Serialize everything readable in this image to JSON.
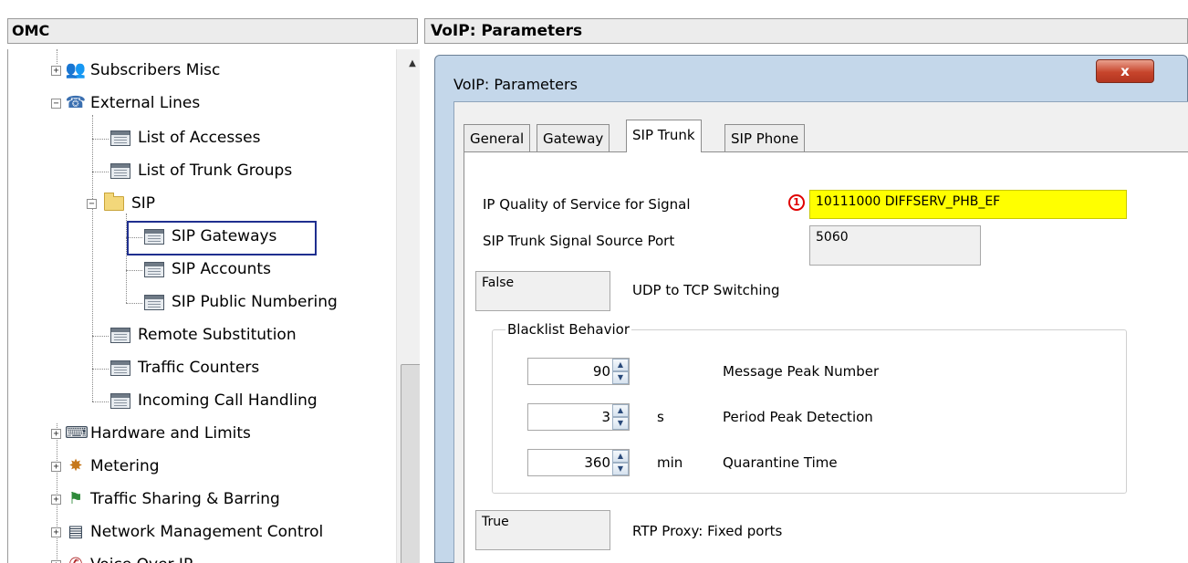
{
  "left_pane": {
    "title": "OMC",
    "tree": [
      {
        "label": "Subscribers Misc",
        "icon": "subscribers-icon",
        "glyph": "👥"
      },
      {
        "label": "External Lines",
        "icon": "external-lines-icon",
        "glyph": "☎"
      },
      {
        "label": "List of Accesses",
        "icon": "list-icon"
      },
      {
        "label": "List of Trunk Groups",
        "icon": "list-icon"
      },
      {
        "label": "SIP",
        "icon": "folder-icon"
      },
      {
        "label": "SIP Gateways",
        "icon": "list-icon",
        "selected": true
      },
      {
        "label": "SIP Accounts",
        "icon": "list-icon"
      },
      {
        "label": "SIP Public Numbering",
        "icon": "list-icon"
      },
      {
        "label": "Remote Substitution",
        "icon": "list-icon"
      },
      {
        "label": "Traffic Counters",
        "icon": "list-icon"
      },
      {
        "label": "Incoming Call Handling",
        "icon": "list-icon"
      },
      {
        "label": "Hardware and Limits",
        "icon": "hardware-icon",
        "glyph": "⌨"
      },
      {
        "label": "Metering",
        "icon": "metering-icon",
        "glyph": "✸"
      },
      {
        "label": "Traffic Sharing & Barring",
        "icon": "traffic-icon",
        "glyph": "⚑"
      },
      {
        "label": "Network Management Control",
        "icon": "network-icon",
        "glyph": "▤"
      },
      {
        "label": "Voice Over IP",
        "icon": "voip-icon",
        "glyph": "✆"
      }
    ]
  },
  "right_pane": {
    "title": "VoIP: Parameters",
    "dialog": {
      "title": "VoIP: Parameters",
      "close_label": "x",
      "tabs": [
        "General",
        "Gateway",
        "SIP Trunk",
        "SIP Phone"
      ],
      "active_tab": "SIP Trunk",
      "fields": {
        "ip_qos_label": "IP Quality of Service for Signal",
        "ip_qos_value": "10111000 DIFFSERV_PHB_EF",
        "annotation": "1",
        "source_port_label": "SIP Trunk Signal Source Port",
        "source_port_value": "5060",
        "udp_tcp_value": "False",
        "udp_tcp_label": "UDP to TCP Switching",
        "rtp_value": "True",
        "rtp_label": "RTP Proxy: Fixed ports"
      },
      "blacklist": {
        "title": "Blacklist Behavior",
        "rows": [
          {
            "value": "90",
            "unit": "",
            "label": "Message Peak Number"
          },
          {
            "value": "3",
            "unit": "s",
            "label": "Period Peak Detection"
          },
          {
            "value": "360",
            "unit": "min",
            "label": "Quarantine Time"
          }
        ]
      }
    }
  },
  "colors": {
    "highlight_field": "#ffff00",
    "selection_box": "#1f2f8f",
    "annotation": "#e00000",
    "close_button": "#c7452c",
    "dialog_frame": "#c4d7ea"
  }
}
